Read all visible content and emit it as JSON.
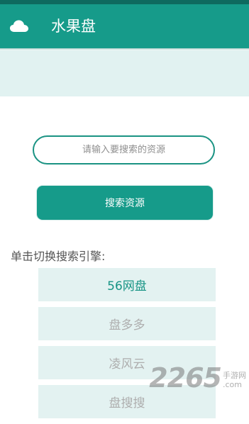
{
  "app_bar": {
    "title": "水果盘",
    "icon": "cloud-icon"
  },
  "search": {
    "placeholder": "请输入要搜索的资源",
    "button_label": "搜索资源"
  },
  "engines": {
    "label": "单击切换搜索引擎:",
    "items": [
      {
        "label": "56网盘",
        "active": true
      },
      {
        "label": "盘多多",
        "active": false
      },
      {
        "label": "凌风云",
        "active": false
      },
      {
        "label": "盘搜搜",
        "active": false
      }
    ]
  },
  "watermark": {
    "number": "2265",
    "site_name": "手游网",
    "domain": ".com"
  },
  "colors": {
    "primary": "#169b8a",
    "primary_dark": "#0e6a5f",
    "light_teal": "#e1f2f1"
  }
}
